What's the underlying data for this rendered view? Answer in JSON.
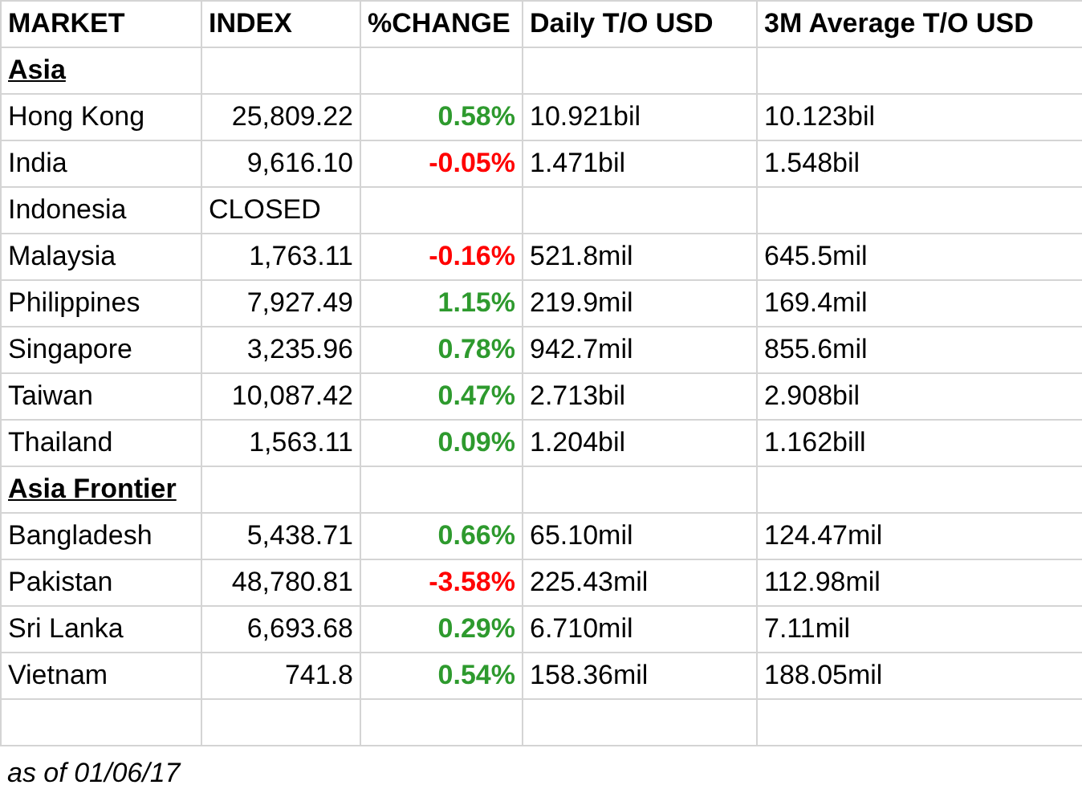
{
  "columns": [
    "MARKET",
    "INDEX",
    "%CHANGE",
    "Daily T/O USD",
    "3M Average T/O USD"
  ],
  "sections": [
    {
      "title": "Asia",
      "rows": [
        {
          "market": "Hong Kong",
          "index": "25,809.22",
          "change": "0.58%",
          "color": "#2e9a2e",
          "daily": "10.921bil",
          "average": "10.123bil"
        },
        {
          "market": "India",
          "index": "9,616.10",
          "change": "-0.05%",
          "color": "#ff0000",
          "daily": "1.471bil",
          "average": "1.548bil"
        },
        {
          "market": "Indonesia",
          "index": "CLOSED"
        },
        {
          "market": "Malaysia",
          "index": "1,763.11",
          "change": "-0.16%",
          "color": "#ff0000",
          "daily": "521.8mil",
          "average": "645.5mil"
        },
        {
          "market": "Philippines",
          "index": "7,927.49",
          "change": "1.15%",
          "color": "#2e9a2e",
          "daily": "219.9mil",
          "average": "169.4mil"
        },
        {
          "market": "Singapore",
          "index": "3,235.96",
          "change": "0.78%",
          "color": "#2e9a2e",
          "daily": "942.7mil",
          "average": "855.6mil"
        },
        {
          "market": "Taiwan",
          "index": "10,087.42",
          "change": "0.47%",
          "color": "#2e9a2e",
          "daily": "2.713bil",
          "average": "2.908bil"
        },
        {
          "market": "Thailand",
          "index": "1,563.11",
          "change": "0.09%",
          "color": "#2e9a2e",
          "daily": "1.204bil",
          "average": "1.162bill"
        }
      ]
    },
    {
      "title": "Asia Frontier",
      "rows": [
        {
          "market": "Bangladesh",
          "index": "5,438.71",
          "change": "0.66%",
          "color": "#2e9a2e",
          "daily": "65.10mil",
          "average": "124.47mil"
        },
        {
          "market": "Pakistan",
          "index": "48,780.81",
          "change": "-3.58%",
          "color": "#ff0000",
          "daily": "225.43mil",
          "average": "112.98mil"
        },
        {
          "market": "Sri Lanka",
          "index": "6,693.68",
          "change": "0.29%",
          "color": "#2e9a2e",
          "daily": "6.710mil",
          "average": "7.11mil"
        },
        {
          "market": "Vietnam",
          "index": "741.8",
          "change": "0.54%",
          "color": "#2e9a2e",
          "daily": "158.36mil",
          "average": "188.05mil"
        }
      ]
    }
  ],
  "footnote": "as of 01/06/17"
}
